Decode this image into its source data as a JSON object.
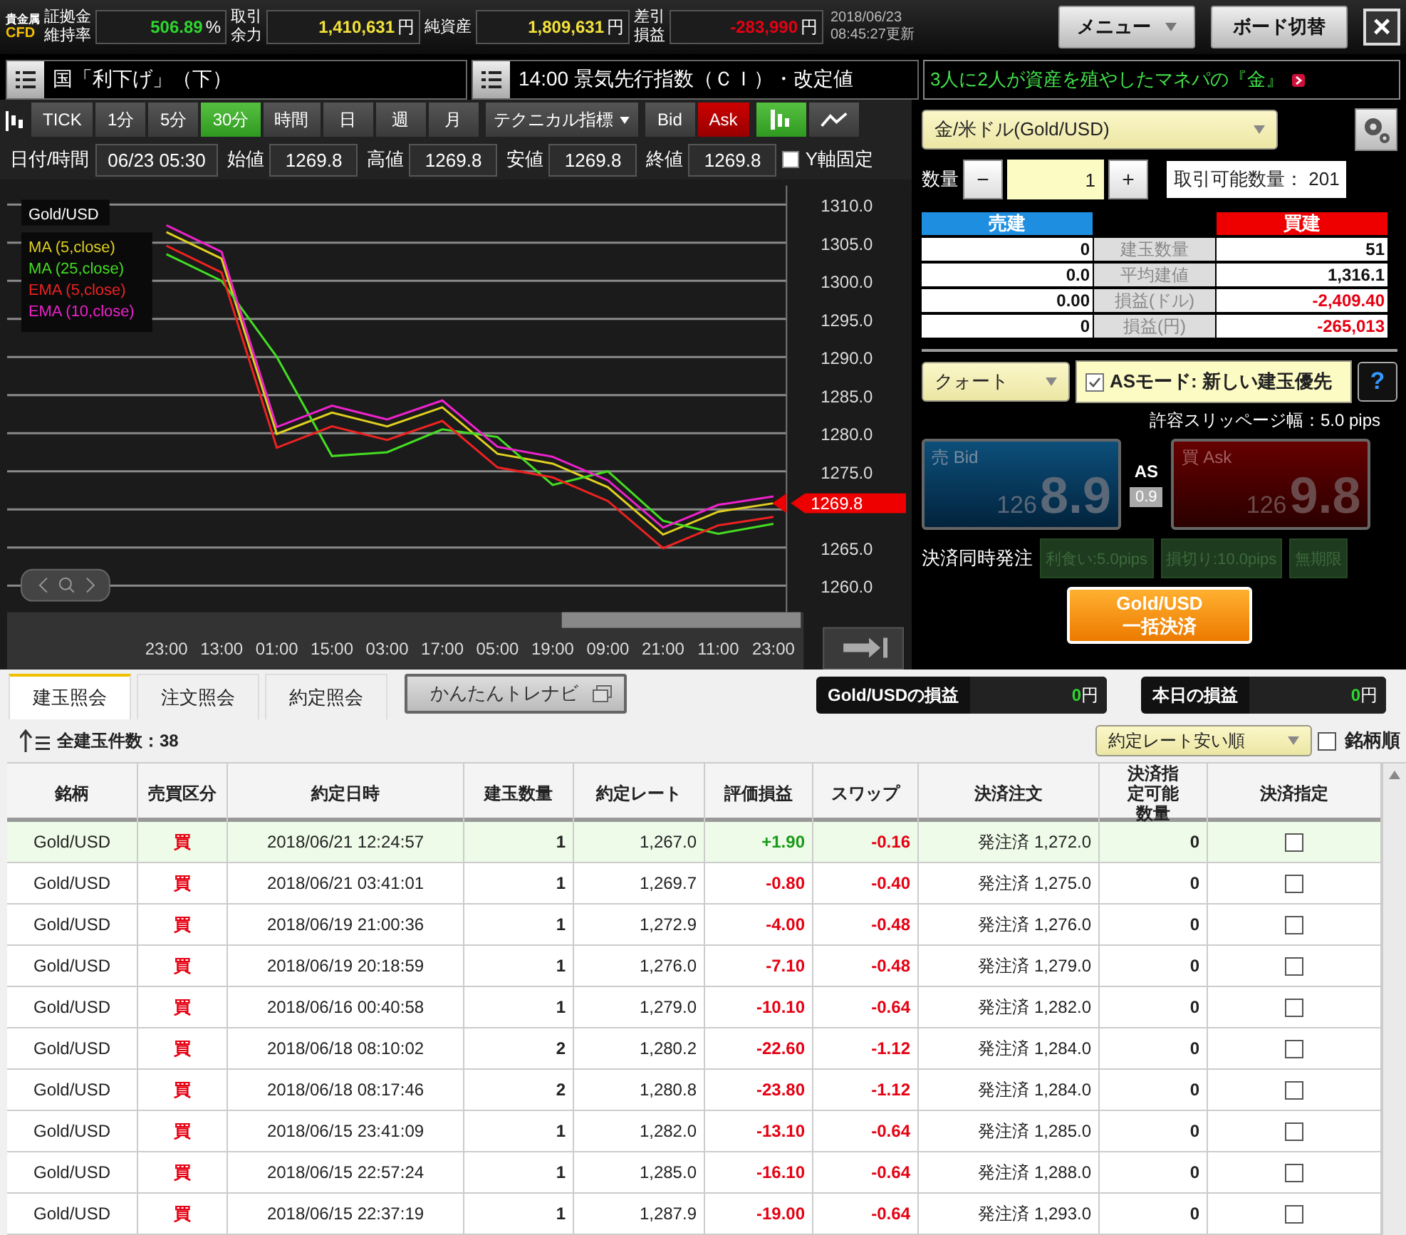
{
  "header": {
    "logo": [
      "貴金属",
      "CFD"
    ],
    "stats": [
      {
        "label": [
          "証拠金",
          "維持率"
        ],
        "value": "506.89",
        "unit": "%",
        "kind": "gain"
      },
      {
        "label": [
          "取引",
          "余力"
        ],
        "value": "1,410,631",
        "unit": "円",
        "kind": "neutral"
      },
      {
        "label": [
          "純資産"
        ],
        "value": "1,809,631",
        "unit": "円",
        "kind": "neutral"
      },
      {
        "label": [
          "差引",
          "損益"
        ],
        "value": "-283,990",
        "unit": "円",
        "kind": "loss"
      }
    ],
    "timestamp": [
      "2018/06/23",
      "08:45:27更新"
    ],
    "menu_button": "メニュー",
    "board_button": "ボード切替",
    "close": "×"
  },
  "news": [
    {
      "text": "国「利下げ」（下）",
      "kind": "plain"
    },
    {
      "text": "14:00 景気先行指数（ＣＩ）・改定値",
      "kind": "plain"
    },
    {
      "text": "3人に2人が資産を殖やしたマネパの『金』",
      "kind": "promo"
    }
  ],
  "chart_toolbar": {
    "periods": [
      {
        "label": "TICK",
        "selected": false
      },
      {
        "label": "1分",
        "selected": false
      },
      {
        "label": "5分",
        "selected": false
      },
      {
        "label": "30分",
        "selected": true
      },
      {
        "label": "時間",
        "selected": false
      },
      {
        "label": "日",
        "selected": false
      },
      {
        "label": "週",
        "selected": false
      },
      {
        "label": "月",
        "selected": false
      }
    ],
    "indicator": "テクニカル指標",
    "sides": [
      {
        "label": "Bid",
        "kind": "bid",
        "selected": false
      },
      {
        "label": "Ask",
        "kind": "ask",
        "selected": true
      }
    ],
    "chart_types": [
      {
        "kind": "candle",
        "selected": true
      },
      {
        "kind": "line",
        "selected": false
      }
    ]
  },
  "ohlc": {
    "fields": [
      {
        "label": "日付/時間",
        "value": "06/23 05:30"
      },
      {
        "label": "始値",
        "value": "1269.8"
      },
      {
        "label": "高値",
        "value": "1269.8"
      },
      {
        "label": "安値",
        "value": "1269.8"
      },
      {
        "label": "終値",
        "value": "1269.8"
      }
    ],
    "y_fixed": {
      "label": "Y軸固定",
      "checked": false
    }
  },
  "chart": {
    "price_tag": "1269.8",
    "chart_data": {
      "type": "line",
      "title": "Gold/USD",
      "grid": true,
      "categories": [
        "23:00",
        "13:00",
        "01:00",
        "15:00",
        "03:00",
        "17:00",
        "05:00",
        "19:00",
        "09:00",
        "21:00",
        "11:00",
        "23:00"
      ],
      "ylim": [
        1256.5,
        1312.5
      ],
      "yticks": [
        {
          "value": 1260,
          "label": "1260.0"
        },
        {
          "value": 1265,
          "label": "1265.0"
        },
        {
          "value": 1275,
          "label": "1275.0"
        },
        {
          "value": 1280,
          "label": "1280.0"
        },
        {
          "value": 1285,
          "label": "1285.0"
        },
        {
          "value": 1290,
          "label": "1290.0"
        },
        {
          "value": 1295,
          "label": "1295.0"
        },
        {
          "value": 1300,
          "label": "1300.0"
        },
        {
          "value": 1305,
          "label": "1305.0"
        },
        {
          "value": 1310,
          "label": "1310.0"
        }
      ],
      "series": [
        {
          "name": "MA (5,close)",
          "color": "#e0d020",
          "values": [
            1306.4,
            1302.9,
            1279.9,
            1282.7,
            1280.9,
            1283.4,
            1277.3,
            1276,
            1272.9,
            1266.7,
            1269.7,
            1270.8
          ]
        },
        {
          "name": "MA (25,close)",
          "color": "#44dd22",
          "values": [
            1303.5,
            1300,
            1290,
            1277,
            1277.5,
            1280.5,
            1279.5,
            1273.2,
            1275,
            1268.5,
            1266.8,
            1268.1
          ]
        },
        {
          "name": "EMA (5,close)",
          "color": "#ee2222",
          "values": [
            1304.6,
            1301.1,
            1278.1,
            1280.9,
            1279.1,
            1281.6,
            1275.5,
            1274.2,
            1271.1,
            1264.9,
            1267.9,
            1269
          ]
        },
        {
          "name": "EMA (10,close)",
          "color": "#ee22cc",
          "values": [
            1307.3,
            1303.8,
            1280.8,
            1283.6,
            1281.8,
            1284.3,
            1278.2,
            1276.9,
            1273.8,
            1267.6,
            1270.6,
            1271.7
          ]
        }
      ]
    }
  },
  "order_panel": {
    "instrument": "金/米ドル(Gold/USD)",
    "qty_label": "数量",
    "minus": "−",
    "qty": "1",
    "plus": "+",
    "available_label": "取引可能数量：",
    "available": "201",
    "sell_header": "売建",
    "buy_header": "買建",
    "positions": [
      {
        "label": "建玉数量",
        "sell": "0",
        "buy": "51",
        "kind": "plain"
      },
      {
        "label": "平均建値",
        "sell": "0.0",
        "buy": "1,316.1",
        "kind": "plain"
      },
      {
        "label": "損益(ドル)",
        "sell": "0.00",
        "buy": "-2,409.40",
        "kind": "loss"
      },
      {
        "label": "損益(円)",
        "sell": "0",
        "buy": "-265,013",
        "kind": "loss"
      }
    ],
    "order_type": "クォート",
    "as_mode": {
      "label": "ASモード: 新しい建玉優先",
      "checked": true
    },
    "help": "?",
    "slippage": "許容スリッページ幅：5.0 pips",
    "bid": {
      "label": "売 Bid",
      "small": "126",
      "big": "8.9"
    },
    "ask": {
      "label": "買 Ask",
      "small": "126",
      "big": "9.8"
    },
    "spread_label": "AS",
    "spread": "0.9",
    "settle_label": "決済同時発注",
    "settle_options": [
      "利食い:5.0pips",
      "損切り:10.0pips",
      "無期限"
    ],
    "bulk": [
      "Gold/USD",
      "一括決済"
    ]
  },
  "positions_view": {
    "tabs": [
      {
        "label": "建玉照会",
        "selected": true
      },
      {
        "label": "注文照会",
        "selected": false
      },
      {
        "label": "約定照会",
        "selected": false
      }
    ],
    "navi_button": "かんたんトレナビ",
    "pl_boxes": [
      {
        "label": "Gold/USDの損益",
        "value": "0",
        "unit": "円"
      },
      {
        "label": "本日の損益",
        "value": "0",
        "unit": "円"
      }
    ],
    "count": "全建玉件数：38",
    "sort": "約定レート安い順",
    "by_symbol": {
      "label": "銘柄順",
      "checked": false
    },
    "columns": [
      "銘柄",
      "売買区分",
      "約定日時",
      "建玉数量",
      "約定レート",
      "評価損益",
      "スワップ",
      "決済注文",
      "決済指定可能数量",
      "決済指定"
    ],
    "rows": [
      {
        "symbol": "Gold/USD",
        "side": "買",
        "time": "2018/06/21 12:24:57",
        "qty": "1",
        "rate": "1,267.0",
        "pl": "+1.90",
        "kind": "gain",
        "swap": "-0.16",
        "order": "発注済 1,272.0",
        "settle_qty": "0",
        "checked": false,
        "selected": true
      },
      {
        "symbol": "Gold/USD",
        "side": "買",
        "time": "2018/06/21 03:41:01",
        "qty": "1",
        "rate": "1,269.7",
        "pl": "-0.80",
        "kind": "loss",
        "swap": "-0.40",
        "order": "発注済 1,275.0",
        "settle_qty": "0",
        "checked": false,
        "selected": false
      },
      {
        "symbol": "Gold/USD",
        "side": "買",
        "time": "2018/06/19 21:00:36",
        "qty": "1",
        "rate": "1,272.9",
        "pl": "-4.00",
        "kind": "loss",
        "swap": "-0.48",
        "order": "発注済 1,276.0",
        "settle_qty": "0",
        "checked": false,
        "selected": false
      },
      {
        "symbol": "Gold/USD",
        "side": "買",
        "time": "2018/06/19 20:18:59",
        "qty": "1",
        "rate": "1,276.0",
        "pl": "-7.10",
        "kind": "loss",
        "swap": "-0.48",
        "order": "発注済 1,279.0",
        "settle_qty": "0",
        "checked": false,
        "selected": false
      },
      {
        "symbol": "Gold/USD",
        "side": "買",
        "time": "2018/06/16 00:40:58",
        "qty": "1",
        "rate": "1,279.0",
        "pl": "-10.10",
        "kind": "loss",
        "swap": "-0.64",
        "order": "発注済 1,282.0",
        "settle_qty": "0",
        "checked": false,
        "selected": false
      },
      {
        "symbol": "Gold/USD",
        "side": "買",
        "time": "2018/06/18 08:10:02",
        "qty": "2",
        "rate": "1,280.2",
        "pl": "-22.60",
        "kind": "loss",
        "swap": "-1.12",
        "order": "発注済 1,284.0",
        "settle_qty": "0",
        "checked": false,
        "selected": false
      },
      {
        "symbol": "Gold/USD",
        "side": "買",
        "time": "2018/06/18 08:17:46",
        "qty": "2",
        "rate": "1,280.8",
        "pl": "-23.80",
        "kind": "loss",
        "swap": "-1.12",
        "order": "発注済 1,284.0",
        "settle_qty": "0",
        "checked": false,
        "selected": false
      },
      {
        "symbol": "Gold/USD",
        "side": "買",
        "time": "2018/06/15 23:41:09",
        "qty": "1",
        "rate": "1,282.0",
        "pl": "-13.10",
        "kind": "loss",
        "swap": "-0.64",
        "order": "発注済 1,285.0",
        "settle_qty": "0",
        "checked": false,
        "selected": false
      },
      {
        "symbol": "Gold/USD",
        "side": "買",
        "time": "2018/06/15 22:57:24",
        "qty": "1",
        "rate": "1,285.0",
        "pl": "-16.10",
        "kind": "loss",
        "swap": "-0.64",
        "order": "発注済 1,288.0",
        "settle_qty": "0",
        "checked": false,
        "selected": false
      },
      {
        "symbol": "Gold/USD",
        "side": "買",
        "time": "2018/06/15 22:37:19",
        "qty": "1",
        "rate": "1,287.9",
        "pl": "-19.00",
        "kind": "loss",
        "swap": "-0.64",
        "order": "発注済 1,293.0",
        "settle_qty": "0",
        "checked": false,
        "selected": false
      }
    ]
  }
}
